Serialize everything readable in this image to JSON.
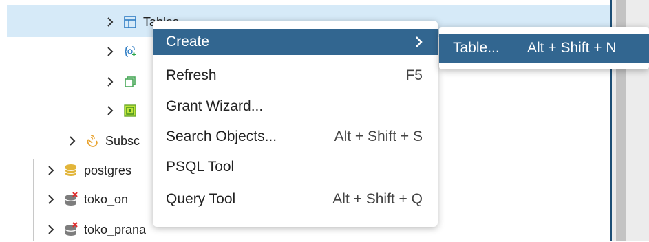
{
  "tree": {
    "items": [
      {
        "label": "Tables",
        "icon": "tables-icon"
      },
      {
        "label": "",
        "icon": "trigger-functions-icon"
      },
      {
        "label": "",
        "icon": "types-icon"
      },
      {
        "label": "",
        "icon": "views-icon"
      },
      {
        "label": "Subsc",
        "icon": "subscriptions-icon"
      },
      {
        "label": "postgres",
        "icon": "database-icon"
      },
      {
        "label": "toko_on",
        "icon": "database-disconnected-icon"
      },
      {
        "label": "toko_prana",
        "icon": "database-disconnected-icon"
      }
    ]
  },
  "context_menu": {
    "items": [
      {
        "label": "Create",
        "shortcut": "",
        "has_submenu": true
      },
      {
        "label": "Refresh",
        "shortcut": "F5"
      },
      {
        "label": "Grant Wizard...",
        "shortcut": ""
      },
      {
        "label": "Search Objects...",
        "shortcut": "Alt + Shift + S"
      },
      {
        "label": "PSQL Tool",
        "shortcut": ""
      },
      {
        "label": "Query Tool",
        "shortcut": "Alt + Shift + Q"
      }
    ]
  },
  "submenu": {
    "items": [
      {
        "label": "Table...",
        "shortcut": "Alt + Shift + N"
      }
    ]
  },
  "colors": {
    "accent": "#326690",
    "selection": "#d6eaf8",
    "divider": "#1d4f76"
  }
}
